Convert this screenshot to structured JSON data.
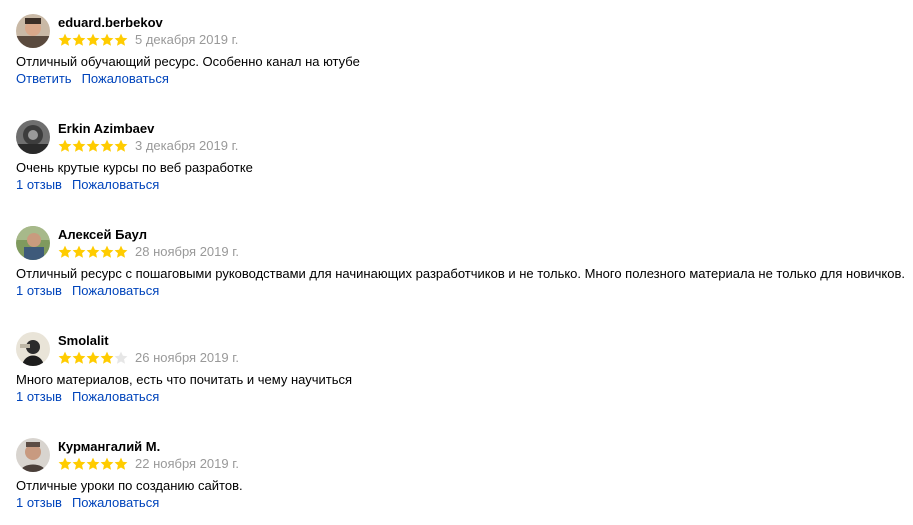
{
  "reviews": [
    {
      "author": "eduard.berbekov",
      "rating": 5,
      "date": "5 декабря 2019 г.",
      "text": "Отличный обучающий ресурс. Особенно канал на ютубе",
      "action_primary": "Ответить",
      "action_report": "Пожаловаться"
    },
    {
      "author": "Erkin Azimbaev",
      "rating": 5,
      "date": "3 декабря 2019 г.",
      "text": "Очень крутые курсы по веб разработке",
      "action_primary": "1 отзыв",
      "action_report": "Пожаловаться"
    },
    {
      "author": "Алексей Баул",
      "rating": 5,
      "date": "28 ноября 2019 г.",
      "text": "Отличный ресурс с пошаговыми руководствами для начинающих разработчиков и не только. Много полезного материала не только для новичков.",
      "action_primary": "1 отзыв",
      "action_report": "Пожаловаться"
    },
    {
      "author": "Smolalit",
      "rating": 4,
      "date": "26 ноября 2019 г.",
      "text": "Много материалов, есть что почитать и чему научиться",
      "action_primary": "1 отзыв",
      "action_report": "Пожаловаться"
    },
    {
      "author": "Курмангалий М.",
      "rating": 5,
      "date": "22 ноября 2019 г.",
      "text": "Отличные уроки по созданию сайтов.",
      "action_primary": "1 отзыв",
      "action_report": "Пожаловаться"
    }
  ],
  "colors": {
    "star_filled": "#fc0",
    "star_empty": "#e6e6e6",
    "date": "#999999",
    "link": "#0044bb"
  },
  "icons": {
    "star": "star-icon"
  }
}
